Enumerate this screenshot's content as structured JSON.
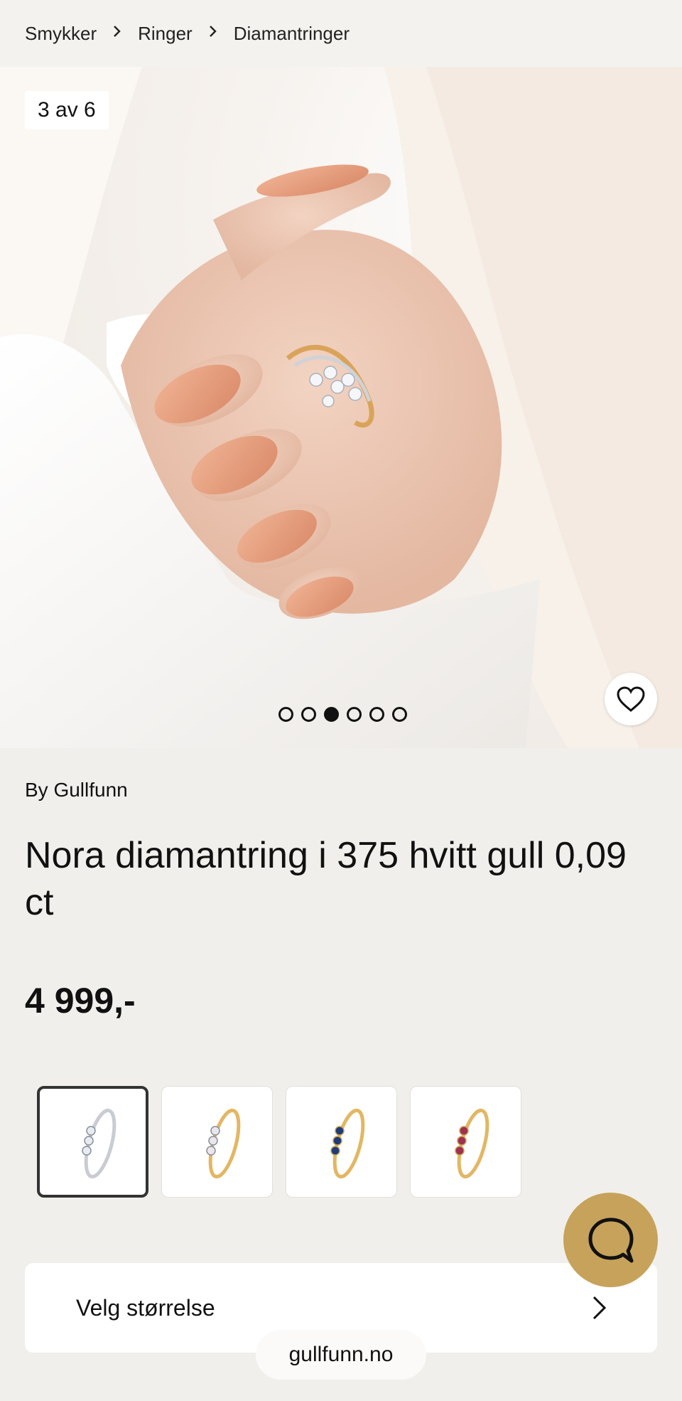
{
  "breadcrumb": {
    "items": [
      "Smykker",
      "Ringer",
      "Diamantringer"
    ],
    "separator": ">"
  },
  "gallery": {
    "counter": "3 av 6",
    "total_images": 6,
    "active_index": 3,
    "favorite_icon": "heart-icon"
  },
  "product": {
    "brand": "By Gullfunn",
    "title": "Nora diamantring i 375 hvitt gull 0,09 ct",
    "price": "4 999,-"
  },
  "variants": [
    {
      "name": "white-gold-diamond",
      "selected": true,
      "band_color": "#c9ccd2",
      "stone_color": "#e8ecf2"
    },
    {
      "name": "yellow-gold-diamond",
      "selected": false,
      "band_color": "#e2b764",
      "stone_color": "#e9e6ee"
    },
    {
      "name": "yellow-gold-sapphire",
      "selected": false,
      "band_color": "#e2b764",
      "stone_color": "#1f3c78"
    },
    {
      "name": "yellow-gold-ruby",
      "selected": false,
      "band_color": "#e2b764",
      "stone_color": "#a0304f"
    }
  ],
  "size_selector": {
    "label": "Velg størrelse",
    "icon": "chevron-right-icon"
  },
  "chat": {
    "icon": "chat-bubble-icon",
    "color": "#c7a25a"
  },
  "domain": "gullfunn.no",
  "colors": {
    "background": "#f0efec",
    "accent": "#c7a25a",
    "text": "#111111"
  }
}
